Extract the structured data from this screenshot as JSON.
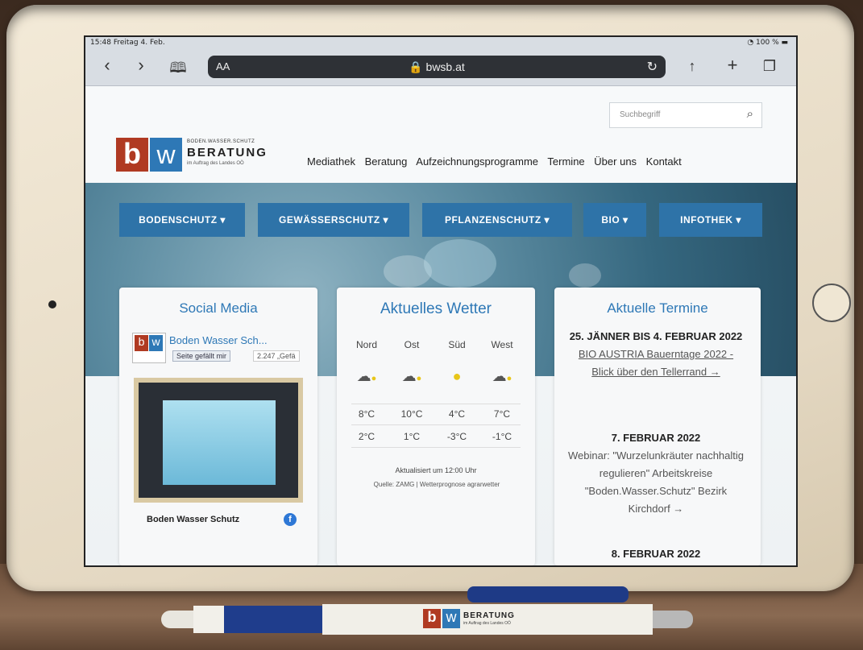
{
  "status": {
    "time": "15:48",
    "date": "Freitag 4. Feb.",
    "battery": "100 %"
  },
  "browser": {
    "aa": "AA",
    "url": "bwsb.at"
  },
  "site": {
    "search_placeholder": "Suchbegriff",
    "logo": {
      "b": "b",
      "w": "w",
      "line1": "BODEN.WASSER.SCHUTZ",
      "line2": "BERATUNG",
      "line3": "im Auftrag des Landes OÖ"
    },
    "top_nav": [
      "Mediathek",
      "Beratung",
      "Aufzeichnungsprogramme",
      "Termine",
      "Über uns",
      "Kontakt"
    ],
    "main_menu": [
      "BODENSCHUTZ ▾",
      "GEWÄSSERSCHUTZ ▾",
      "PFLANZENSCHUTZ ▾",
      "BIO ▾",
      "INFOTHEK ▾"
    ],
    "social": {
      "title": "Social Media",
      "page_name": "Boden Wasser Sch...",
      "like": "Seite gefällt mir",
      "count": "2.247 „Gefä",
      "footer": "Boden Wasser Schutz"
    },
    "weather": {
      "title": "Aktuelles Wetter",
      "regions": [
        "Nord",
        "Ost",
        "Süd",
        "West"
      ],
      "icons": [
        "partly-cloudy-icon",
        "partly-cloudy-icon",
        "sun-icon",
        "partly-cloudy-icon"
      ],
      "high": [
        "8°C",
        "10°C",
        "4°C",
        "7°C"
      ],
      "low": [
        "2°C",
        "1°C",
        "-3°C",
        "-1°C"
      ],
      "updated": "Aktualisiert um 12:00 Uhr",
      "source": "Quelle: ZAMG | Wetterprognose agrarwetter"
    },
    "events": {
      "title": "Aktuelle Termine",
      "items": [
        {
          "date": "25. JÄNNER BIS 4. FEBRUAR 2022",
          "text": "BIO AUSTRIA Bauerntage 2022 - Blick über den Tellerrand →"
        },
        {
          "date": "7. FEBRUAR 2022",
          "text": "Webinar: \"Wurzelunkräuter nachhaltig regulieren\" Arbeitskreise \"Boden.Wasser.Schutz\" Bezirk Kirchdorf →"
        },
        {
          "date": "8. FEBRUAR 2022",
          "text": ""
        }
      ]
    }
  },
  "pen_logo": {
    "b": "b",
    "w": "w",
    "line1": "BERATUNG",
    "line2": "im Auftrag des Landes OÖ"
  }
}
